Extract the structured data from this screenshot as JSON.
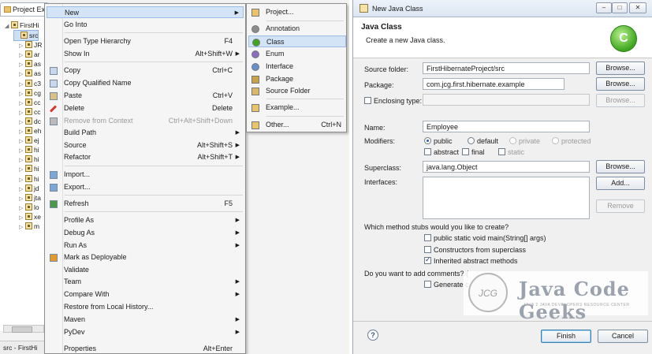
{
  "explorer": {
    "tab_label": "Project Exp",
    "project": "FirstHi",
    "rows": [
      "src",
      "JR",
      "ar",
      "as",
      "as",
      "c3",
      "cg",
      "cc",
      "cc",
      "dc",
      "eh",
      "ej",
      "hi",
      "hi",
      "hi",
      "hi",
      "jd",
      "jta",
      "lo",
      "xe",
      "m"
    ],
    "status": "src - FirstHi"
  },
  "context_menu": {
    "items": [
      {
        "label": "New",
        "shortcut": "",
        "submenu": true,
        "highlight": true
      },
      {
        "label": "Go Into",
        "shortcut": ""
      },
      {
        "label": "Open Type Hierarchy",
        "shortcut": "F4"
      },
      {
        "label": "Show In",
        "shortcut": "Alt+Shift+W",
        "submenu": true
      },
      {
        "label": "Copy",
        "shortcut": "Ctrl+C"
      },
      {
        "label": "Copy Qualified Name",
        "shortcut": ""
      },
      {
        "label": "Paste",
        "shortcut": "Ctrl+V"
      },
      {
        "label": "Delete",
        "shortcut": "Delete"
      },
      {
        "label": "Remove from Context",
        "shortcut": "Ctrl+Alt+Shift+Down",
        "disabled": true
      },
      {
        "label": "Build Path",
        "shortcut": "",
        "submenu": true
      },
      {
        "label": "Source",
        "shortcut": "Alt+Shift+S",
        "submenu": true
      },
      {
        "label": "Refactor",
        "shortcut": "Alt+Shift+T",
        "submenu": true
      },
      {
        "label": "Import...",
        "shortcut": ""
      },
      {
        "label": "Export...",
        "shortcut": ""
      },
      {
        "label": "Refresh",
        "shortcut": "F5"
      },
      {
        "label": "Profile As",
        "shortcut": "",
        "submenu": true
      },
      {
        "label": "Debug As",
        "shortcut": "",
        "submenu": true
      },
      {
        "label": "Run As",
        "shortcut": "",
        "submenu": true
      },
      {
        "label": "Mark as Deployable",
        "shortcut": ""
      },
      {
        "label": "Validate",
        "shortcut": ""
      },
      {
        "label": "Team",
        "shortcut": "",
        "submenu": true
      },
      {
        "label": "Compare With",
        "shortcut": "",
        "submenu": true
      },
      {
        "label": "Restore from Local History...",
        "shortcut": ""
      },
      {
        "label": "Maven",
        "shortcut": "",
        "submenu": true
      },
      {
        "label": "PyDev",
        "shortcut": "",
        "submenu": true
      },
      {
        "label": "Properties",
        "shortcut": "Alt+Enter"
      }
    ]
  },
  "submenu": {
    "items": [
      {
        "label": "Project...",
        "shortcut": ""
      },
      {
        "label": "Annotation",
        "shortcut": ""
      },
      {
        "label": "Class",
        "shortcut": "",
        "highlight": true
      },
      {
        "label": "Enum",
        "shortcut": ""
      },
      {
        "label": "Interface",
        "shortcut": ""
      },
      {
        "label": "Package",
        "shortcut": ""
      },
      {
        "label": "Source Folder",
        "shortcut": ""
      },
      {
        "label": "Example...",
        "shortcut": ""
      },
      {
        "label": "Other...",
        "shortcut": "Ctrl+N"
      }
    ]
  },
  "dialog": {
    "title": "New Java Class",
    "header_title": "Java Class",
    "header_desc": "Create a new Java class.",
    "logo_letter": "C",
    "source_folder_label": "Source folder:",
    "source_folder_value": "FirstHibernateProject/src",
    "package_label": "Package:",
    "package_value": "com.jcg.first.hibernate.example",
    "enclosing_label": "Enclosing type:",
    "name_label": "Name:",
    "name_value": "Employee",
    "modifiers_label": "Modifiers:",
    "mod_public": "public",
    "mod_default": "default",
    "mod_private": "private",
    "mod_protected": "protected",
    "mod_abstract": "abstract",
    "mod_final": "final",
    "mod_static": "static",
    "superclass_label": "Superclass:",
    "superclass_value": "java.lang.Object",
    "interfaces_label": "Interfaces:",
    "browse": "Browse...",
    "add": "Add...",
    "remove": "Remove",
    "stubs_question": "Which method stubs would you like to create?",
    "stub_main": "public static void main(String[] args)",
    "stub_constructors": "Constructors from superclass",
    "stub_inherited": "Inherited abstract methods",
    "comments_question": "Do you want to add comments? (",
    "generate_comments": "Generate c",
    "help": "?",
    "finish": "Finish",
    "cancel": "Cancel",
    "win_min": "–",
    "win_max": "□",
    "win_close": "✕"
  },
  "watermark": {
    "circle_text": "JCG",
    "brand": "Java Code Geeks",
    "tagline": "JAVA 2 JAVA DEVELOPERS RESOURCE CENTER"
  }
}
